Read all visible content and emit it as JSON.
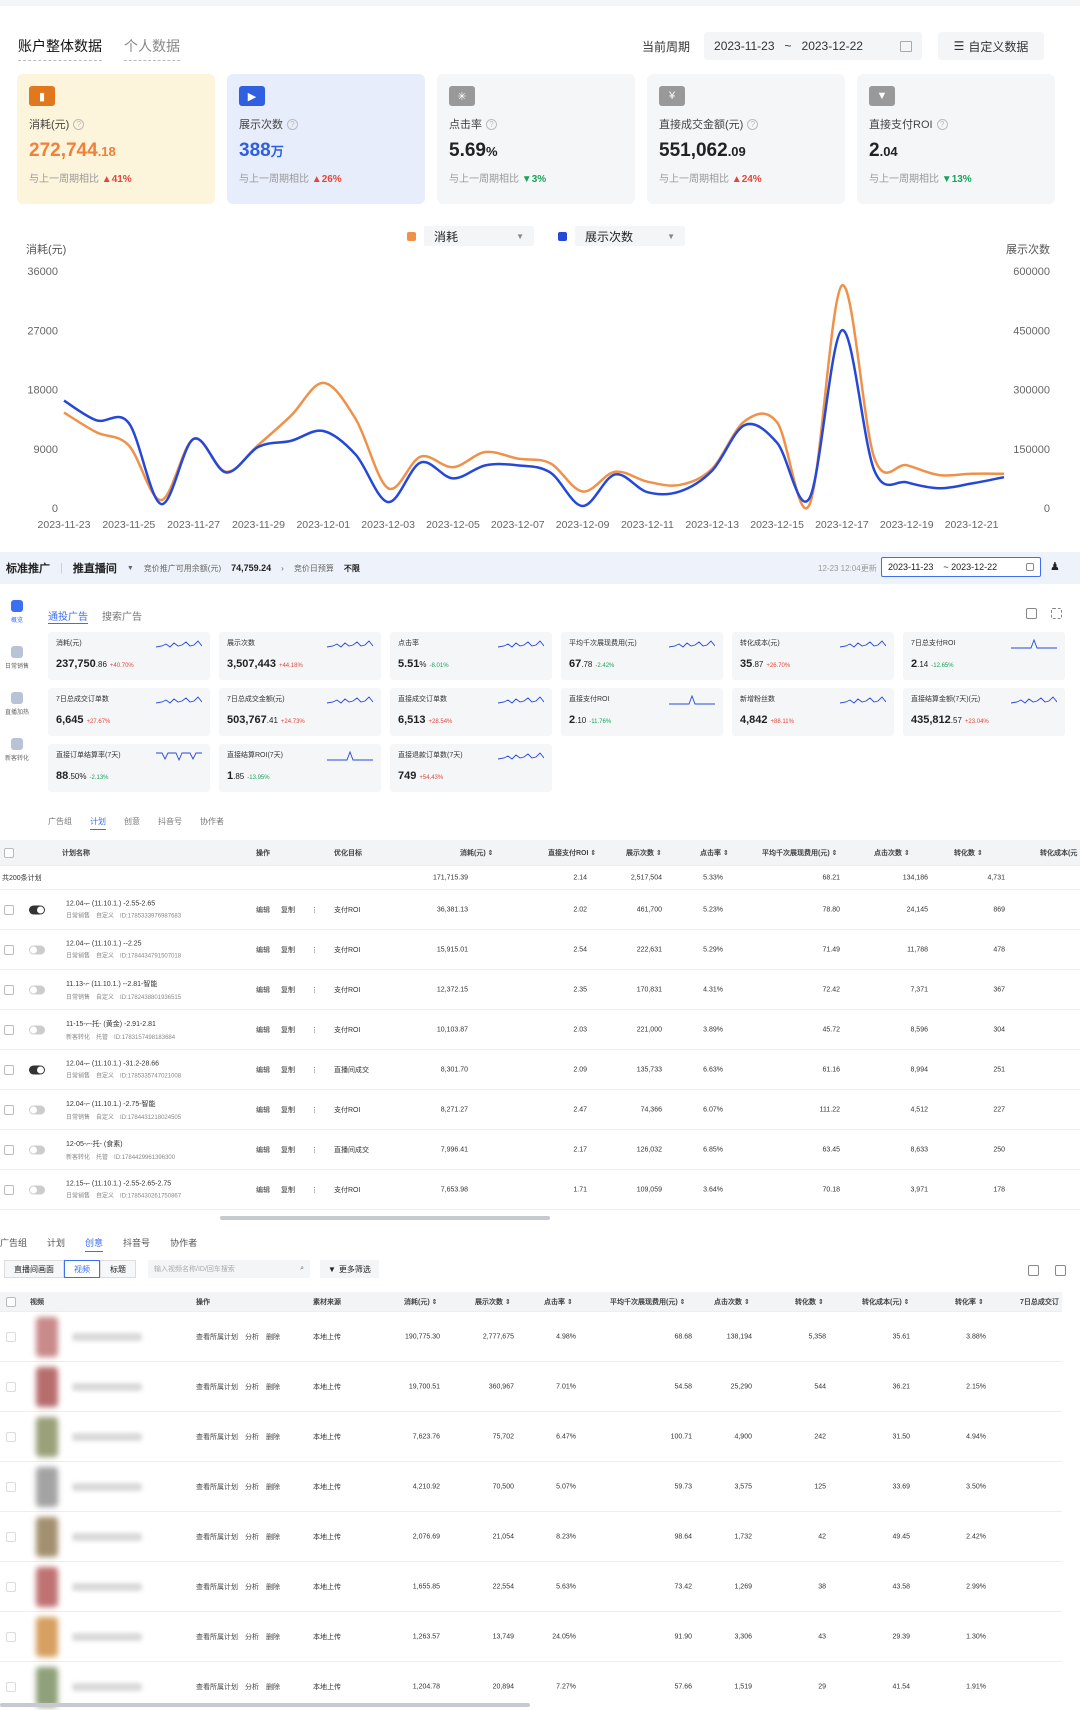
{
  "overview": {
    "tab_active": "账户整体数据",
    "tab_inactive": "个人数据",
    "period_label": "当前周期",
    "date_start": "2023-11-23",
    "date_sep": "~",
    "date_end": "2023-12-22",
    "custom_button": "自定义数据",
    "cards": [
      {
        "title": "消耗(元)",
        "value_main": "272,744",
        "value_small": ".18",
        "compare_label": "与上一周期相比",
        "dir": "up",
        "change": "41%",
        "icon_color": "#e0781d",
        "value_color": "#f0803a"
      },
      {
        "title": "展示次数",
        "value_main": "388",
        "value_small": "万",
        "compare_label": "与上一周期相比",
        "dir": "up",
        "change": "26%",
        "icon_color": "#3060e0",
        "value_color": "#2e5fe0"
      },
      {
        "title": "点击率",
        "value_main": "5.69",
        "value_small": "%",
        "compare_label": "与上一周期相比",
        "dir": "down",
        "change": "3%",
        "icon_color": "#999999",
        "value_color": "#222222"
      },
      {
        "title": "直接成交金额(元)",
        "value_main": "551,062",
        "value_small": ".09",
        "compare_label": "与上一周期相比",
        "dir": "up",
        "change": "24%",
        "icon_color": "#999999",
        "value_color": "#222222"
      },
      {
        "title": "直接支付ROI",
        "value_main": "2",
        "value_small": ".04",
        "compare_label": "与上一周期相比",
        "dir": "down",
        "change": "13%",
        "icon_color": "#999999",
        "value_color": "#222222"
      }
    ],
    "legend": [
      {
        "label": "消耗",
        "color": "#f0914a"
      },
      {
        "label": "展示次数",
        "color": "#2448d8"
      }
    ]
  },
  "chart_data": {
    "type": "line",
    "ylabel": "消耗(元)",
    "y2label": "展示次数",
    "ylim": [
      0,
      36000
    ],
    "y2lim": [
      0,
      600000
    ],
    "yticks": [
      "36000",
      "27000",
      "18000",
      "9000",
      "0"
    ],
    "y2ticks": [
      "600000",
      "450000",
      "300000",
      "150000",
      "0"
    ],
    "x_tick_labels": [
      "2023-11-23",
      "2023-11-25",
      "2023-11-27",
      "2023-11-29",
      "2023-12-01",
      "2023-12-03",
      "2023-12-05",
      "2023-12-07",
      "2023-12-09",
      "2023-12-11",
      "2023-12-13",
      "2023-12-15",
      "2023-12-17",
      "2023-12-19",
      "2023-12-21"
    ],
    "x": [
      "2023-11-23",
      "2023-11-24",
      "2023-11-25",
      "2023-11-26",
      "2023-11-27",
      "2023-11-28",
      "2023-11-29",
      "2023-11-30",
      "2023-12-01",
      "2023-12-02",
      "2023-12-03",
      "2023-12-04",
      "2023-12-05",
      "2023-12-06",
      "2023-12-07",
      "2023-12-08",
      "2023-12-09",
      "2023-12-10",
      "2023-12-11",
      "2023-12-12",
      "2023-12-13",
      "2023-12-14",
      "2023-12-15",
      "2023-12-16",
      "2023-12-17",
      "2023-12-18",
      "2023-12-19",
      "2023-12-20",
      "2023-12-21",
      "2023-12-22"
    ],
    "series": [
      {
        "name": "消耗",
        "axis": "left",
        "color": "#f0914a",
        "values": [
          14500,
          11500,
          9500,
          1200,
          10500,
          5500,
          9600,
          14000,
          19000,
          13500,
          3000,
          7800,
          6200,
          8500,
          7500,
          6800,
          2500,
          5500,
          4000,
          3500,
          6000,
          13200,
          13000,
          500,
          33800,
          7600,
          6500,
          5000,
          5200,
          5200
        ]
      },
      {
        "name": "展示次数",
        "axis": "right",
        "color": "#2448d8",
        "values": [
          272000,
          222000,
          215000,
          10000,
          175000,
          90000,
          155000,
          170000,
          195000,
          135000,
          15000,
          115000,
          75000,
          108000,
          108000,
          90000,
          5000,
          85000,
          40000,
          42000,
          95000,
          210000,
          165000,
          25000,
          450000,
          95000,
          65000,
          50000,
          62000,
          78000
        ]
      }
    ]
  },
  "promo": {
    "title": "标准推广",
    "subtitle": "推直播间",
    "budget_label": "竞价推广可用余额(元)",
    "budget_value": "74,759.24",
    "daily_label": "竞价日预算",
    "daily_value": "不限",
    "scope_text": "12-23 12:04更新",
    "date_start": "2023-11-23",
    "date_end": "~ 2023-12-22",
    "left_nav": [
      "概览",
      "日常销售",
      "直播加热",
      "新客转化"
    ],
    "subtabs": [
      "通投广告",
      "搜索广告"
    ],
    "metrics": [
      {
        "title": "消耗(元)",
        "main": "237,750",
        "small": ".86",
        "dir": "up",
        "chg": "+40.70%",
        "spark": "wave"
      },
      {
        "title": "展示次数",
        "main": "3,507,443",
        "small": "",
        "dir": "up",
        "chg": "+44.18%",
        "spark": "wave"
      },
      {
        "title": "点击率",
        "main": "5.51",
        "small": "%",
        "dir": "down",
        "chg": "-8.01%",
        "spark": "wave"
      },
      {
        "title": "平均千次展现费用(元)",
        "main": "67",
        "small": ".78",
        "dir": "down",
        "chg": "-2.42%",
        "spark": "wave"
      },
      {
        "title": "转化成本(元)",
        "main": "35",
        "small": ".87",
        "dir": "up",
        "chg": "+26.70%",
        "spark": "wave"
      },
      {
        "title": "7日总支付ROI",
        "main": "2",
        "small": ".14",
        "dir": "down",
        "chg": "-12.65%",
        "spark": "spike"
      },
      {
        "title": "7日总成交订单数",
        "main": "6,645",
        "small": "",
        "dir": "up",
        "chg": "+27.67%",
        "spark": "wave"
      },
      {
        "title": "7日总成交金额(元)",
        "main": "503,767",
        "small": ".41",
        "dir": "up",
        "chg": "+24.73%",
        "spark": "wave"
      },
      {
        "title": "直接成交订单数",
        "main": "6,513",
        "small": "",
        "dir": "up",
        "chg": "+28.54%",
        "spark": "wave"
      },
      {
        "title": "直接支付ROI",
        "main": "2",
        "small": ".10",
        "dir": "down",
        "chg": "-11.76%",
        "spark": "spike"
      },
      {
        "title": "新增粉丝数",
        "main": "4,842",
        "small": "",
        "dir": "up",
        "chg": "+88.11%",
        "spark": "wave"
      },
      {
        "title": "直接结算金额(7天)(元)",
        "main": "435,812",
        "small": ".57",
        "dir": "up",
        "chg": "+23.04%",
        "spark": "wave"
      },
      {
        "title": "直接订单结算率(7天)",
        "main": "88",
        "small": ".50%",
        "dir": "down",
        "chg": "-2.13%",
        "spark": "dip"
      },
      {
        "title": "直接结算ROI(7天)",
        "main": "1",
        "small": ".85",
        "dir": "down",
        "chg": "-13.95%",
        "spark": "spike"
      },
      {
        "title": "直接退款订单数(7天)",
        "main": "749",
        "small": "",
        "dir": "up",
        "chg": "+54.43%",
        "spark": "wave"
      }
    ],
    "table_tabs": [
      "广告组",
      "计划",
      "创意",
      "抖音号",
      "协作者"
    ],
    "headers": [
      "计划名称",
      "操作",
      "优化目标",
      "消耗(元) ⇕",
      "直接支付ROI ⇕",
      "展示次数 ⇕",
      "点击率 ⇕",
      "平均千次展现费用(元) ⇕",
      "点击次数 ⇕",
      "转化数 ⇕",
      "转化成本(元"
    ],
    "total_label": "共200条计划",
    "totals": [
      "171,715.39",
      "2.14",
      "2,517,504",
      "5.33%",
      "68.21",
      "134,186",
      "4,731"
    ],
    "op_edit": "编辑",
    "op_copy": "复制",
    "rows": [
      {
        "on": true,
        "name": "12.04-⌐ (11.10.1.) -2.55-2.65",
        "type": "日常销售",
        "mode": "自定义",
        "id": "ID:1785333976987683",
        "goal": "支付ROI",
        "cost": "36,381.13",
        "roi": "2.02",
        "impr": "461,700",
        "ctr": "5.23%",
        "cpm": "78.80",
        "clicks": "24,145",
        "conv": "869"
      },
      {
        "on": false,
        "name": "12.04-⌐ (11.10.1.) --2.25",
        "type": "日常销售",
        "mode": "自定义",
        "id": "ID:1784434791507018",
        "goal": "支付ROI",
        "cost": "15,915.01",
        "roi": "2.54",
        "impr": "222,631",
        "ctr": "5.29%",
        "cpm": "71.49",
        "clicks": "11,788",
        "conv": "478"
      },
      {
        "on": false,
        "name": "11.13-⌐ (11.10.1.) --2.81-智能",
        "type": "日常销售",
        "mode": "自定义",
        "id": "ID:1782438801936515",
        "goal": "支付ROI",
        "cost": "12,372.15",
        "roi": "2.35",
        "impr": "170,831",
        "ctr": "4.31%",
        "cpm": "72.42",
        "clicks": "7,371",
        "conv": "367"
      },
      {
        "on": false,
        "name": "11-15-⌐-托- (黄金) -2.91-2.81",
        "type": "新客转化",
        "mode": "托管",
        "id": "ID:1783157498183684",
        "goal": "支付ROI",
        "cost": "10,103.87",
        "roi": "2.03",
        "impr": "221,000",
        "ctr": "3.89%",
        "cpm": "45.72",
        "clicks": "8,596",
        "conv": "304"
      },
      {
        "on": true,
        "name": "12.04-⌐ (11.10.1.) -31.2-28.66",
        "type": "日常销售",
        "mode": "自定义",
        "id": "ID:1785335747021008",
        "goal": "直播间成交",
        "cost": "8,301.70",
        "roi": "2.09",
        "impr": "135,733",
        "ctr": "6.63%",
        "cpm": "61.16",
        "clicks": "8,994",
        "conv": "251"
      },
      {
        "on": false,
        "name": "12.04-⌐ (11.10.1.) -2.75-智能",
        "type": "日常销售",
        "mode": "自定义",
        "id": "ID:1784431218024505",
        "goal": "支付ROI",
        "cost": "8,271.27",
        "roi": "2.47",
        "impr": "74,366",
        "ctr": "6.07%",
        "cpm": "111.22",
        "clicks": "4,512",
        "conv": "227"
      },
      {
        "on": false,
        "name": "12-05-⌐-托- (食素)",
        "type": "新客转化",
        "mode": "托管",
        "id": "ID:1784429961396300",
        "goal": "直播间成交",
        "cost": "7,996.41",
        "roi": "2.17",
        "impr": "126,032",
        "ctr": "6.85%",
        "cpm": "63.45",
        "clicks": "8,633",
        "conv": "250"
      },
      {
        "on": false,
        "name": "12.15-⌐ (11.10.1.) -2.55-2.65-2.75",
        "type": "日常销售",
        "mode": "自定义",
        "id": "ID:1785430261750867",
        "goal": "支付ROI",
        "cost": "7,653.98",
        "roi": "1.71",
        "impr": "109,059",
        "ctr": "3.64%",
        "cpm": "70.18",
        "clicks": "3,971",
        "conv": "178"
      }
    ]
  },
  "creative": {
    "tabs": [
      "广告组",
      "计划",
      "创意",
      "抖音号",
      "协作者"
    ],
    "segments": [
      "直播间画面",
      "视频",
      "标题"
    ],
    "search_placeholder": "输入视频名称/ID/回车搜索",
    "more_filter": "更多筛选",
    "headers": [
      "视频",
      "操作",
      "素材来源",
      "消耗(元) ⇕",
      "展示次数 ⇕",
      "点击率 ⇕",
      "平均千次展现费用(元) ⇕",
      "点击次数 ⇕",
      "转化数 ⇕",
      "转化成本(元) ⇕",
      "转化率 ⇕",
      "7日总成交订"
    ],
    "op_view": "查看所属计划",
    "op_analyze": "分析",
    "op_delete": "删除",
    "source": "本地上传",
    "rows": [
      {
        "thumb": "#c98a8a",
        "cost": "190,775.30",
        "impr": "2,777,675",
        "ctr": "4.98%",
        "cpm": "68.68",
        "clicks": "138,194",
        "conv": "5,358",
        "cpa": "35.61",
        "cvr": "3.88%"
      },
      {
        "thumb": "#b86d6d",
        "cost": "19,700.51",
        "impr": "360,967",
        "ctr": "7.01%",
        "cpm": "54.58",
        "clicks": "25,290",
        "conv": "544",
        "cpa": "36.21",
        "cvr": "2.15%"
      },
      {
        "thumb": "#9aa07a",
        "cost": "7,623.76",
        "impr": "75,702",
        "ctr": "6.47%",
        "cpm": "100.71",
        "clicks": "4,900",
        "conv": "242",
        "cpa": "31.50",
        "cvr": "4.94%"
      },
      {
        "thumb": "#a3a3a3",
        "cost": "4,210.92",
        "impr": "70,500",
        "ctr": "5.07%",
        "cpm": "59.73",
        "clicks": "3,575",
        "conv": "125",
        "cpa": "33.69",
        "cvr": "3.50%"
      },
      {
        "thumb": "#a39070",
        "cost": "2,076.69",
        "impr": "21,054",
        "ctr": "8.23%",
        "cpm": "98.64",
        "clicks": "1,732",
        "conv": "42",
        "cpa": "49.45",
        "cvr": "2.42%"
      },
      {
        "thumb": "#c07272",
        "cost": "1,655.85",
        "impr": "22,554",
        "ctr": "5.63%",
        "cpm": "73.42",
        "clicks": "1,269",
        "conv": "38",
        "cpa": "43.58",
        "cvr": "2.99%"
      },
      {
        "thumb": "#d6a060",
        "cost": "1,263.57",
        "impr": "13,749",
        "ctr": "24.05%",
        "cpm": "91.90",
        "clicks": "3,306",
        "conv": "43",
        "cpa": "29.39",
        "cvr": "1.30%"
      },
      {
        "thumb": "#8fa07a",
        "cost": "1,204.78",
        "impr": "20,894",
        "ctr": "7.27%",
        "cpm": "57.66",
        "clicks": "1,519",
        "conv": "29",
        "cpa": "41.54",
        "cvr": "1.91%"
      }
    ]
  }
}
